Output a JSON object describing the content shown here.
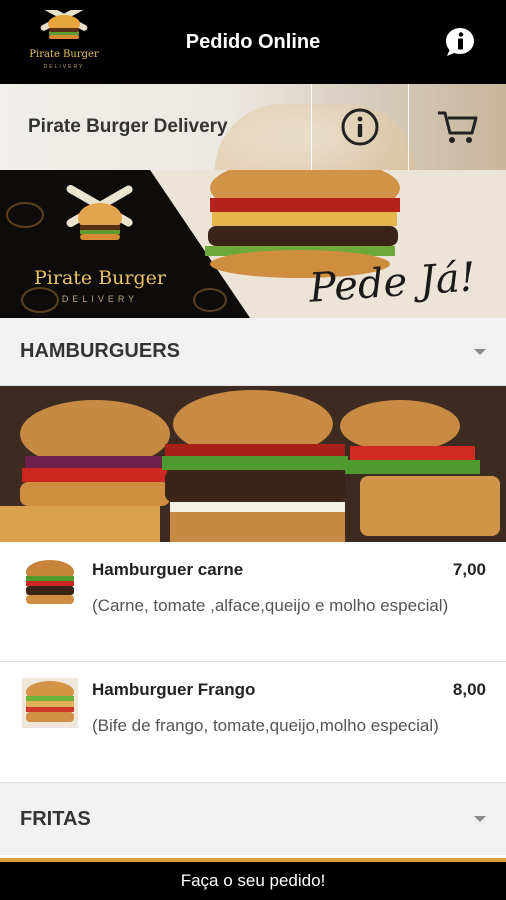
{
  "app": {
    "title": "Pedido Online"
  },
  "logo": {
    "name": "Pirate Burger",
    "sub": "DELIVERY"
  },
  "store": {
    "name": "Pirate Burger Delivery"
  },
  "banner": {
    "logo_name": "Pirate Burger",
    "logo_sub": "DELIVERY",
    "slogan": "Pede Já!"
  },
  "categories": [
    {
      "label": "HAMBURGUERS"
    },
    {
      "label": "FRITAS"
    }
  ],
  "items": [
    {
      "name": "Hamburguer carne",
      "price": "7,00",
      "description": "(Carne, tomate ,alface,queijo e molho especial)"
    },
    {
      "name": "Hamburguer Frango",
      "price": "8,00",
      "description": "(Bife de frango, tomate,queijo,molho especial)"
    }
  ],
  "footer": {
    "cta": "Faça o seu pedido!"
  },
  "colors": {
    "topbar": "#000000",
    "accent": "#d9a23a",
    "category_bg": "#f1f1f1"
  }
}
